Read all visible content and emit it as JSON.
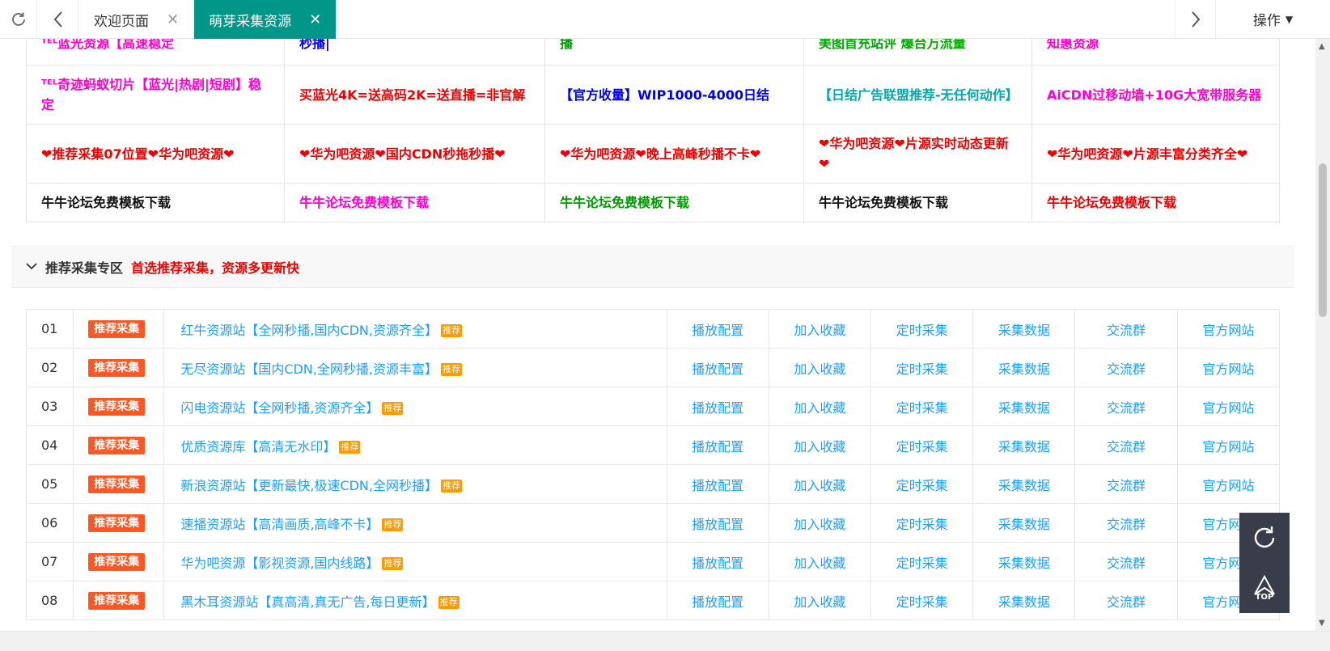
{
  "tabs": {
    "refresh_icon": "refresh-icon",
    "back_icon": "chevron-left-icon",
    "items": [
      {
        "label": "欢迎页面",
        "close": "✕"
      },
      {
        "label": "萌芽采集资源",
        "close": "✕"
      }
    ],
    "forward_icon": "chevron-right-icon",
    "ops_label": "操作",
    "accent": "#009688"
  },
  "ads": {
    "rows": [
      [
        {
          "text": "ᵀᴱᴸ蓝光资源【高速稳定",
          "color": "#ff00cc"
        },
        {
          "text": "秒播|",
          "color": "#0000ee"
        },
        {
          "text": "播",
          "color": "#009900"
        },
        {
          "text": "美图首充站评 爆台万流量",
          "color": "#00aa00"
        },
        {
          "text": "知惠资源",
          "color": "#ff00cc"
        }
      ],
      [
        {
          "text": "ᵀᴱᴸ奇迹蚂蚁切片【蓝光|热剧|短剧】稳定",
          "color": "#ff00cc"
        },
        {
          "text": "买蓝光4K=送高码2K=送直播=非官解",
          "color": "#ee0000"
        },
        {
          "text": "【官方收量】WIP1000-4000日结",
          "color": "#0000ee"
        },
        {
          "text": "【日结广告联盟推荐-无任何动作】",
          "color": "#00aaaa"
        },
        {
          "text": "AiCDN过移动墙+10G大宽带服务器",
          "color": "#ff00cc"
        }
      ],
      [
        {
          "text": "❤推荐采集07位置❤华为吧资源❤",
          "color": "#ee0000"
        },
        {
          "text": "❤华为吧资源❤国内CDN秒拖秒播❤",
          "color": "#ee0000"
        },
        {
          "text": "❤华为吧资源❤晚上高峰秒播不卡❤",
          "color": "#ee0000"
        },
        {
          "text": "❤华为吧资源❤片源实时动态更新❤",
          "color": "#ee0000"
        },
        {
          "text": "❤华为吧资源❤片源丰富分类齐全❤",
          "color": "#ee0000"
        }
      ],
      [
        {
          "text": "牛牛论坛免费模板下载",
          "color": "#111111"
        },
        {
          "text": "牛牛论坛免费模板下载",
          "color": "#ff00cc"
        },
        {
          "text": "牛牛论坛免费模板下载",
          "color": "#009900"
        },
        {
          "text": "牛牛论坛免费模板下载",
          "color": "#111111"
        },
        {
          "text": "牛牛论坛免费模板下载",
          "color": "#ee0000"
        }
      ]
    ]
  },
  "section": {
    "chevron_icon": "chevron-down-icon",
    "title": "推荐采集专区",
    "subtitle": "首选推荐采集，资源多更新快"
  },
  "list": {
    "actions": [
      "播放配置",
      "加入收藏",
      "定时采集",
      "采集数据",
      "交流群",
      "官方网站"
    ],
    "rows": [
      {
        "num": "01",
        "tag": "推荐采集",
        "name": "红牛资源站【全网秒播,国内CDN,资源齐全】",
        "badge": "推荐"
      },
      {
        "num": "02",
        "tag": "推荐采集",
        "name": "无尽资源站【国内CDN,全网秒播,资源丰富】",
        "badge": "推荐"
      },
      {
        "num": "03",
        "tag": "推荐采集",
        "name": "闪电资源站【全网秒播,资源齐全】",
        "badge": "推荐"
      },
      {
        "num": "04",
        "tag": "推荐采集",
        "name": "优质资源库【高清无水印】",
        "badge": "推荐"
      },
      {
        "num": "05",
        "tag": "推荐采集",
        "name": "新浪资源站【更新最快,极速CDN,全网秒播】",
        "badge": "推荐"
      },
      {
        "num": "06",
        "tag": "推荐采集",
        "name": "速播资源站【高清画质,高峰不卡】",
        "badge": "推荐"
      },
      {
        "num": "07",
        "tag": "推荐采集",
        "name": "华为吧资源【影视资源,国内线路】",
        "badge": "推荐"
      },
      {
        "num": "08",
        "tag": "推荐采集",
        "name": "黑木耳资源站【真高清,真无广告,每日更新】",
        "badge": "推荐"
      }
    ]
  },
  "fixbar": {
    "refresh_icon": "refresh-icon",
    "top_label": "TOP"
  }
}
